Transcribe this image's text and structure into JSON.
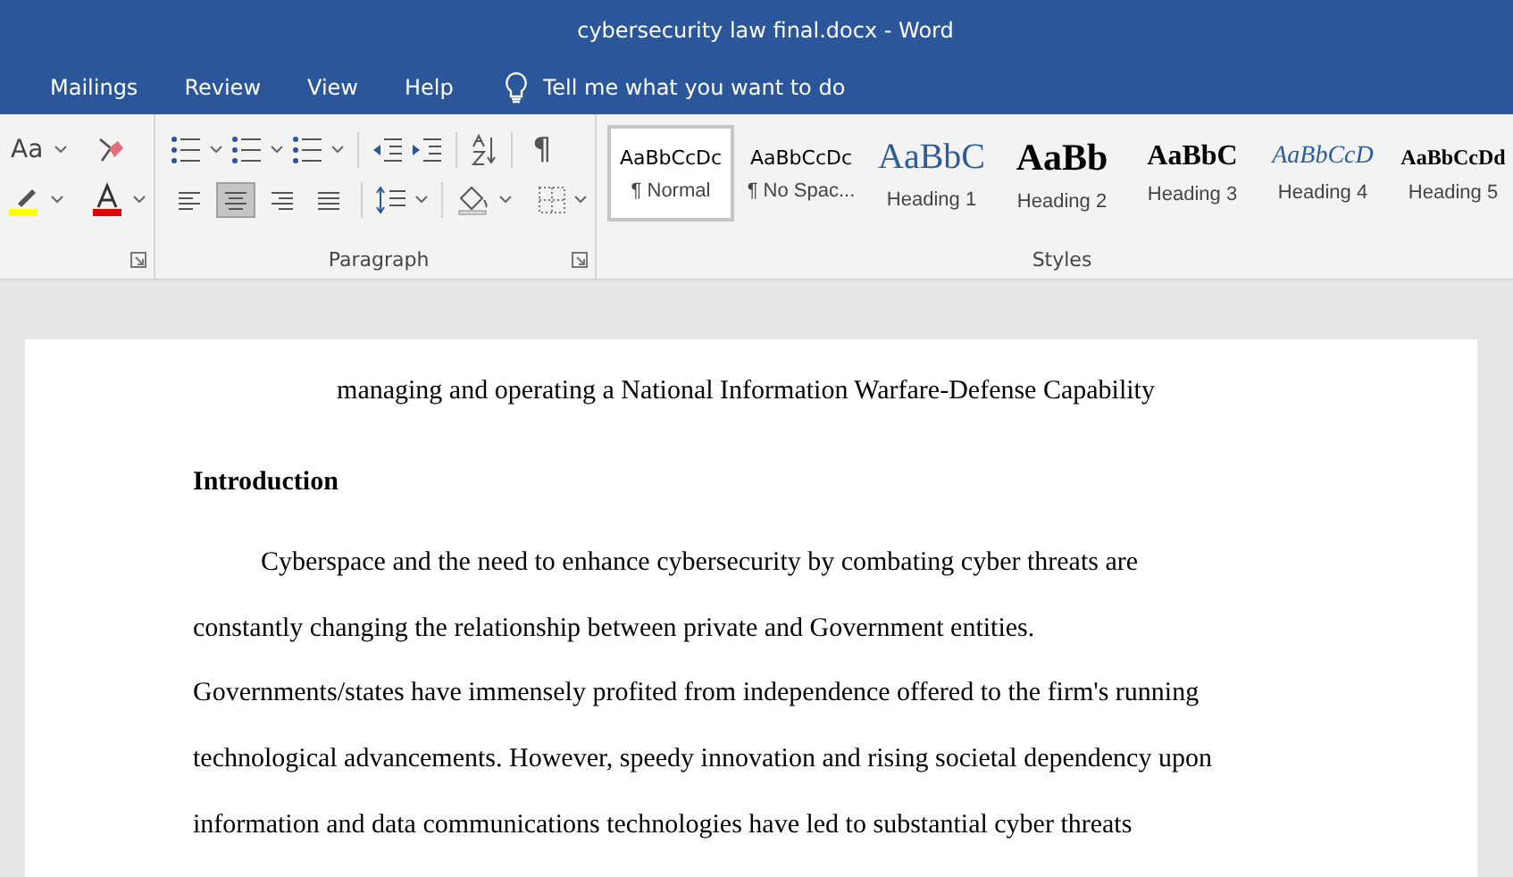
{
  "window": {
    "title": "cybersecurity law final.docx  -  Word"
  },
  "tabs": [
    {
      "label": "Mailings",
      "selected": false
    },
    {
      "label": "Review",
      "selected": false
    },
    {
      "label": "View",
      "selected": false
    },
    {
      "label": "Help",
      "selected": false
    }
  ],
  "tell_me": {
    "placeholder": "Tell me what you want to do"
  },
  "font_group": {
    "change_case": "Aa"
  },
  "paragraph_group": {
    "label": "Paragraph",
    "pilcrow": "¶",
    "alignments": [
      {
        "kind": "left",
        "selected": false
      },
      {
        "kind": "center",
        "selected": true
      },
      {
        "kind": "right",
        "selected": false
      },
      {
        "kind": "justify",
        "selected": false
      }
    ]
  },
  "styles_group": {
    "label": "Styles",
    "styles": [
      {
        "preview": "AaBbCcDc",
        "name": "¶ Normal",
        "kind": "normal",
        "selected": true
      },
      {
        "preview": "AaBbCcDc",
        "name": "¶ No Spac...",
        "kind": "normal",
        "selected": false
      },
      {
        "preview": "AaBbC",
        "name": "Heading 1",
        "kind": "h1",
        "selected": false
      },
      {
        "preview": "AaBb",
        "name": "Heading 2",
        "kind": "h2",
        "selected": false
      },
      {
        "preview": "AaBbC",
        "name": "Heading 3",
        "kind": "h3",
        "selected": false
      },
      {
        "preview": "AaBbCcD",
        "name": "Heading 4",
        "kind": "h4",
        "selected": false
      },
      {
        "preview": "AaBbCcDd",
        "name": "Heading 5",
        "kind": "h5",
        "selected": false
      }
    ]
  },
  "document": {
    "title_line": "managing and operating a National Information Warfare-Defense Capability",
    "heading": "Introduction",
    "lines": [
      "Cyberspace and the need to enhance cybersecurity by combating cyber threats are",
      "constantly changing the relationship between private and Government entities.",
      "Governments/states have immensely profited from independence offered to the firm's running",
      "technological advancements. However, speedy innovation and rising societal dependency upon",
      "information and data communications technologies have led to substantial cyber threats"
    ]
  }
}
